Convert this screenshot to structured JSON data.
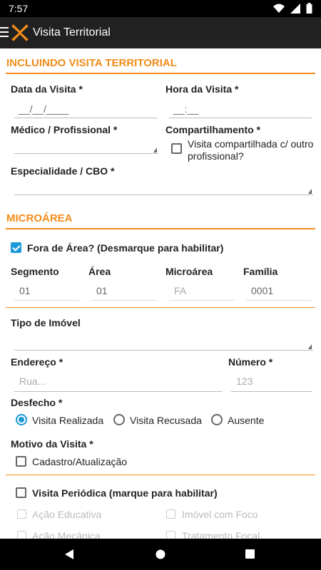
{
  "status": {
    "time": "7:57"
  },
  "app": {
    "title": "Visita Territorial"
  },
  "section1": {
    "title": "INCLUINDO VISITA TERRITORIAL",
    "date_label": "Data da Visita *",
    "date_value": "__/__/____",
    "time_label": "Hora da Visita *",
    "time_value": "__:__",
    "medico_label": "Médico / Profissional *",
    "compart_label": "Compartilhamento *",
    "compart_checkbox": "Visita compartilhada c/ outro profissional?",
    "especialidade_label": "Especialidade / CBO *"
  },
  "section2": {
    "title": "MICROÁREA",
    "fora_area": "Fora de Área? (Desmarque para habilitar)",
    "segmento_label": "Segmento",
    "segmento_value": "01",
    "area_label": "Área",
    "area_value": "01",
    "microarea_label": "Microárea",
    "microarea_value": "FA",
    "familia_label": "Família",
    "familia_value": "0001",
    "tipo_imovel_label": "Tipo de Imóvel",
    "endereco_label": "Endereço *",
    "endereco_placeholder": "Rua...",
    "numero_label": "Número *",
    "numero_placeholder": "123",
    "desfecho_label": "Desfecho *",
    "desfecho_options": [
      "Visita Realizada",
      "Visita Recusada",
      "Ausente"
    ],
    "motivo_label": "Motivo da Visita *",
    "motivo_option": "Cadastro/Atualização"
  },
  "section3": {
    "periodica": "Visita Periódica (marque para habilitar)",
    "options": [
      "Ação Educativa",
      "Imóvel com Foco",
      "Ação Mecânica",
      "Tratamento Focal"
    ]
  },
  "colors": {
    "accent": "#f28c1a",
    "checked": "#1c9ad6"
  }
}
